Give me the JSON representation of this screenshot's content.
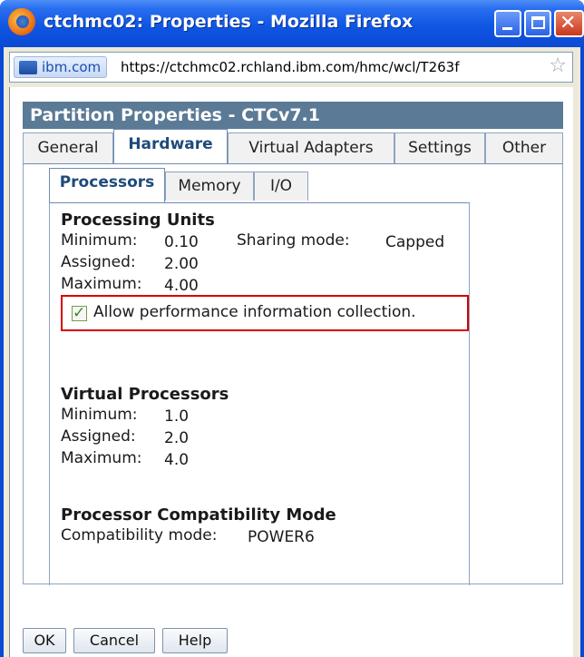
{
  "window": {
    "title": "ctchmc02: Properties - Mozilla Firefox",
    "icon": "firefox-icon",
    "controls": {
      "minimize": "minimize-icon",
      "maximize": "maximize-icon",
      "close": "close-icon"
    },
    "close_glyph": "✕"
  },
  "urlbar": {
    "site_badge": "ibm.com",
    "url": "https://ctchmc02.rchland.ibm.com/hmc/wcl/T263f",
    "star": "☆"
  },
  "panel": {
    "title": "Partition Properties - CTCv7.1"
  },
  "tabs": [
    {
      "label": "General",
      "active": false
    },
    {
      "label": "Hardware",
      "active": true
    },
    {
      "label": "Virtual Adapters",
      "active": false
    },
    {
      "label": "Settings",
      "active": false
    },
    {
      "label": "Other",
      "active": false
    }
  ],
  "subtabs": [
    {
      "label": "Processors",
      "active": true
    },
    {
      "label": "Memory",
      "active": false
    },
    {
      "label": "I/O",
      "active": false
    }
  ],
  "processing_units": {
    "title": "Processing Units",
    "minimum_label": "Minimum:",
    "minimum_value": "0.10",
    "assigned_label": "Assigned:",
    "assigned_value": "2.00",
    "maximum_label": "Maximum:",
    "maximum_value": "4.00",
    "sharing_label": "Sharing mode:",
    "sharing_value": "Capped"
  },
  "perf_checkbox": {
    "checked": true,
    "label": "Allow performance information collection.",
    "check_glyph": "✓"
  },
  "virtual_processors": {
    "title": "Virtual Processors",
    "minimum_label": "Minimum:",
    "minimum_value": "1.0",
    "assigned_label": "Assigned:",
    "assigned_value": "2.0",
    "maximum_label": "Maximum:",
    "maximum_value": "4.0"
  },
  "compat": {
    "title": "Processor Compatibility Mode",
    "label": "Compatibility mode:",
    "value": "POWER6"
  },
  "buttons": {
    "ok": "OK",
    "cancel": "Cancel",
    "help": "Help"
  },
  "colors": {
    "title_bar": "#0b4ad4",
    "panel_header": "#5a7a96",
    "highlight_border": "#d60000",
    "active_tab_text": "#1d4a7c"
  }
}
